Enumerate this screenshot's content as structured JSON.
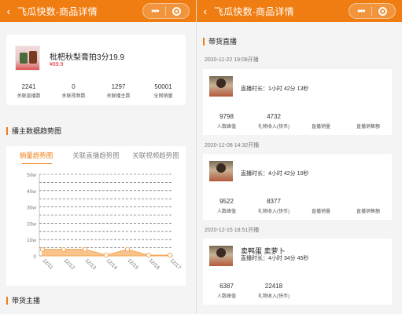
{
  "left": {
    "topbar": {
      "title": "飞瓜快数-商品详情"
    },
    "product": {
      "name": "枇杷秋梨膏拍3分19.9",
      "price": "¥89.9",
      "stats": [
        {
          "value": "2241",
          "label": "关联直播数"
        },
        {
          "value": "0",
          "label": "关联视频数"
        },
        {
          "value": "1297",
          "label": "关联播主数"
        },
        {
          "value": "50001",
          "label": "全网销量"
        }
      ]
    },
    "trend_section": {
      "title": "播主数据趋势图"
    },
    "tabs": [
      "销量趋势图",
      "关联直播趋势图",
      "关联视频趋势图"
    ],
    "bottom_section": {
      "title": "带货主播"
    },
    "chart_data": {
      "type": "area",
      "x": [
        "12/11",
        "12/12",
        "12/13",
        "12/14",
        "12/15",
        "12/16",
        "12/17"
      ],
      "series": [
        {
          "values": [
            40000,
            40000,
            40000,
            5000,
            40000,
            5000,
            5000
          ]
        }
      ],
      "yticks": [
        "0",
        "5w",
        "10w",
        "15w",
        "20w",
        "25w",
        "30w",
        "35w",
        "40w",
        "45w",
        "50w"
      ],
      "ylim": [
        0,
        500000
      ],
      "grid": true,
      "color": "#f8c48c"
    }
  },
  "right": {
    "topbar": {
      "title": "飞瓜快数-商品详情"
    },
    "section": {
      "title": "带货直播"
    },
    "lives": [
      {
        "date": "2020-11-22 19:08开播",
        "title": "",
        "duration": "直播时长：1小时 42分 13秒",
        "stats": [
          {
            "value": "9798",
            "label": "人数峰值"
          },
          {
            "value": "4732",
            "label": "礼物收入(快币)"
          },
          {
            "value": "",
            "label": "直播销量"
          },
          {
            "value": "",
            "label": "直播销售额"
          }
        ]
      },
      {
        "date": "2020-12-08 14:32开播",
        "title": "",
        "duration": "直播时长：4小时 42分 10秒",
        "stats": [
          {
            "value": "9522",
            "label": "人数峰值"
          },
          {
            "value": "8377",
            "label": "礼物收入(快币)"
          },
          {
            "value": "",
            "label": "直播销量"
          },
          {
            "value": "",
            "label": "直播销售额"
          }
        ]
      },
      {
        "date": "2020-12-15 18:51开播",
        "title": "卖鸭蛋 卖萝卜",
        "duration": "直播时长：4小时 34分 45秒",
        "stats": [
          {
            "value": "6387",
            "label": "人数峰值"
          },
          {
            "value": "22418",
            "label": "礼物收入(快币)"
          },
          {
            "value": "",
            "label": ""
          },
          {
            "value": "",
            "label": ""
          }
        ]
      }
    ]
  }
}
